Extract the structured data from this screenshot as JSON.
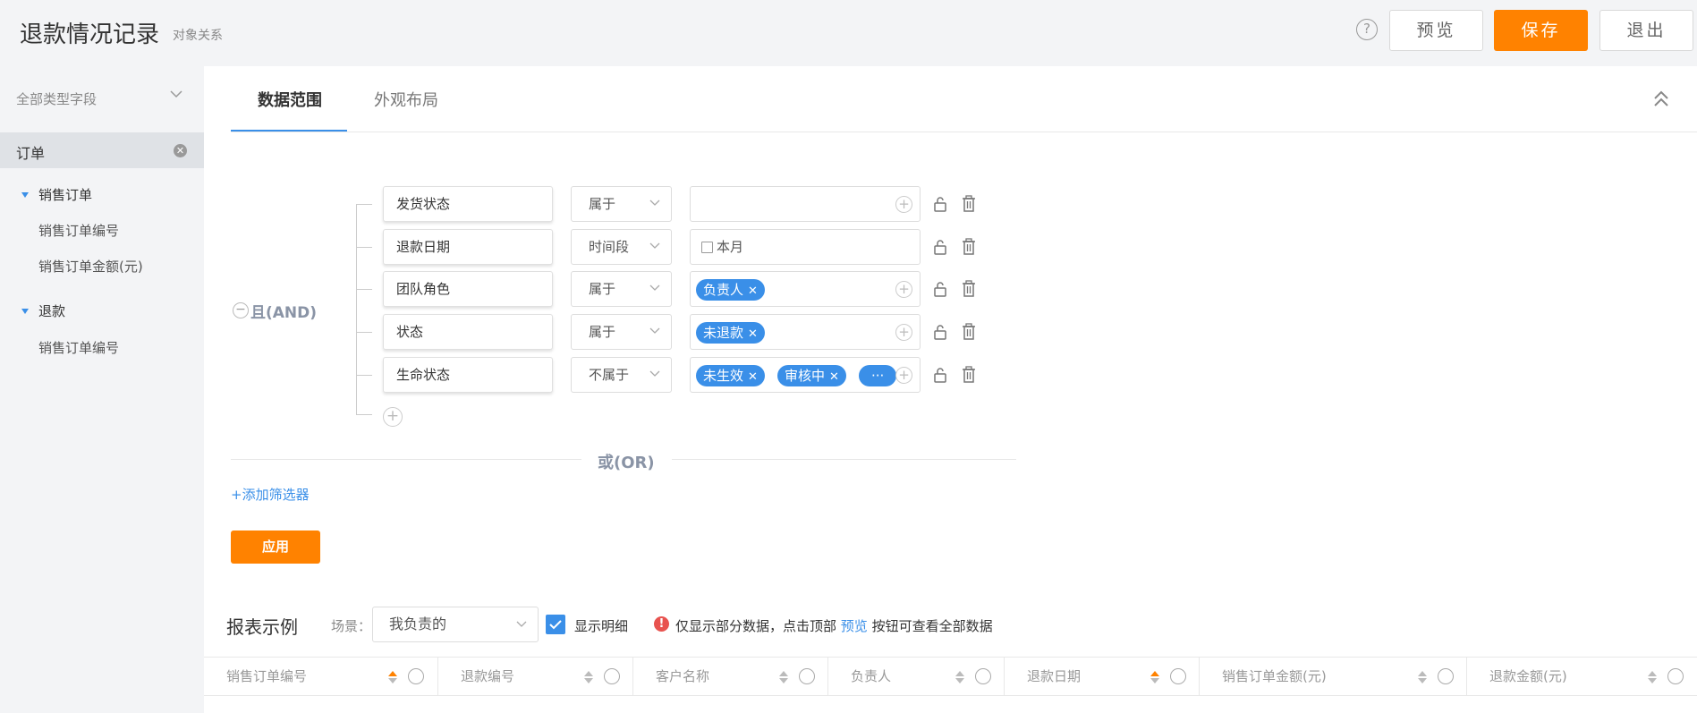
{
  "header": {
    "title": "退款情况记录",
    "subtitle": "对象关系",
    "help_symbol": "?",
    "preview_label": "预览",
    "save_label": "保存",
    "exit_label": "退出"
  },
  "sidebar": {
    "type_filter": "全部类型字段",
    "selected_object": "订单",
    "groups": [
      {
        "label": "销售订单",
        "items": [
          "销售订单编号",
          "销售订单金额(元)"
        ]
      },
      {
        "label": "退款",
        "items": [
          "销售订单编号"
        ]
      }
    ]
  },
  "tabs": {
    "data_range": "数据范围",
    "appearance": "外观布局"
  },
  "filter": {
    "and_label": "且(AND)",
    "or_label": "或(OR)",
    "conditions": [
      {
        "field": "发货状态",
        "operator": "属于",
        "values": []
      },
      {
        "field": "退款日期",
        "operator": "时间段",
        "date_value": "本月"
      },
      {
        "field": "团队角色",
        "operator": "属于",
        "values": [
          "负责人"
        ]
      },
      {
        "field": "状态",
        "operator": "属于",
        "values": [
          "未退款"
        ]
      },
      {
        "field": "生命状态",
        "operator": "不属于",
        "values": [
          "未生效",
          "审核中",
          "···"
        ]
      }
    ],
    "add_filter_label": "+添加筛选器",
    "apply_label": "应用",
    "chip_remove_symbol": "✕"
  },
  "report": {
    "title": "报表示例",
    "scene_label": "场景：",
    "scene_value": "我负责的",
    "show_detail_label": "显示明细",
    "show_detail_checked": true,
    "notice_prefix": "仅显示部分数据，点击顶部",
    "notice_link": "预览",
    "notice_suffix": "按钮可查看全部数据",
    "columns": [
      "销售订单编号",
      "退款编号",
      "客户名称",
      "负责人",
      "退款日期",
      "销售订单金额(元)",
      "退款金额(元)"
    ]
  },
  "colors": {
    "accent": "#3a8fe8",
    "primary": "#ff8200",
    "warning": "#e8534f"
  }
}
